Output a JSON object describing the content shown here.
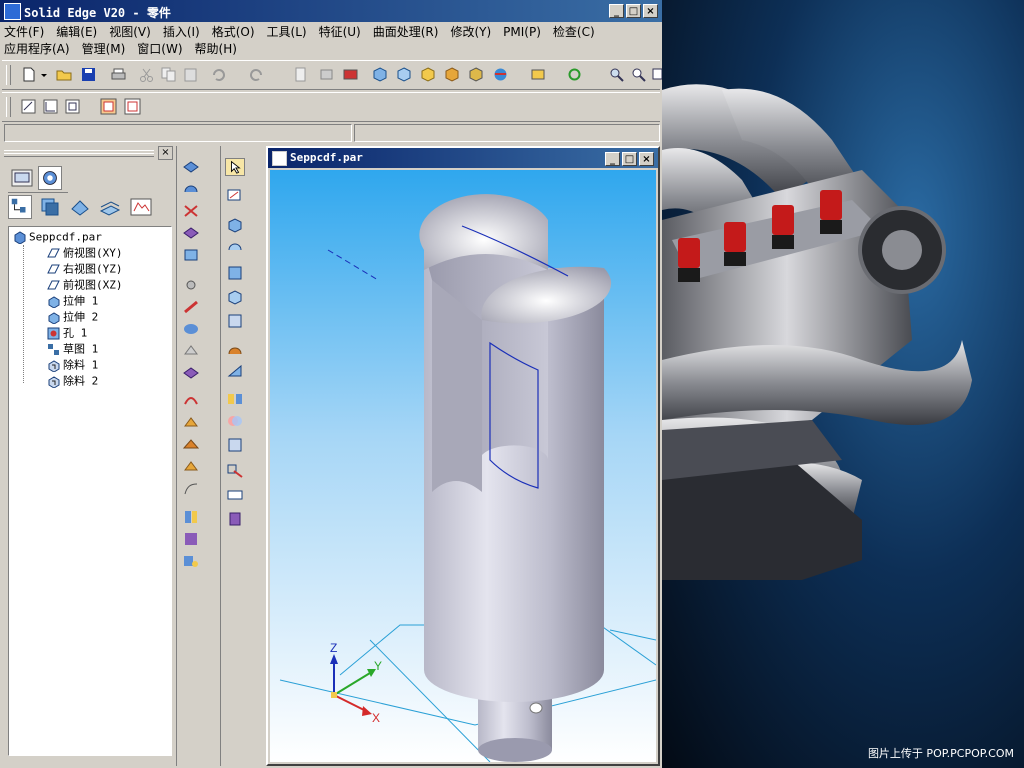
{
  "window": {
    "title": "Solid Edge V20 - 零件"
  },
  "menu": {
    "row1": [
      "文件(F)",
      "编辑(E)",
      "视图(V)",
      "插入(I)",
      "格式(O)",
      "工具(L)",
      "特征(U)",
      "曲面处理(R)",
      "修改(Y)",
      "PMI(P)",
      "检查(C)"
    ],
    "row2": [
      "应用程序(A)",
      "管理(M)",
      "窗口(W)",
      "帮助(H)"
    ]
  },
  "document": {
    "title": "Seppcdf.par"
  },
  "tree": {
    "root": "Seppcdf.par",
    "items": [
      "俯视图(XY)",
      "右视图(YZ)",
      "前视图(XZ)",
      "拉伸 1",
      "拉伸 2",
      "孔 1",
      "草图 1",
      "除料 1",
      "除料 2"
    ]
  },
  "triad": {
    "z": "Z",
    "y": "Y",
    "x": "X"
  },
  "photo": {
    "caption": "图片上传于 POP.PCPOP.COM"
  },
  "colors": {
    "title_start": "#0a246a",
    "title_end": "#3a6ea5",
    "viewport_top": "#2fa7ee",
    "chrome": "#d4d0c8"
  }
}
